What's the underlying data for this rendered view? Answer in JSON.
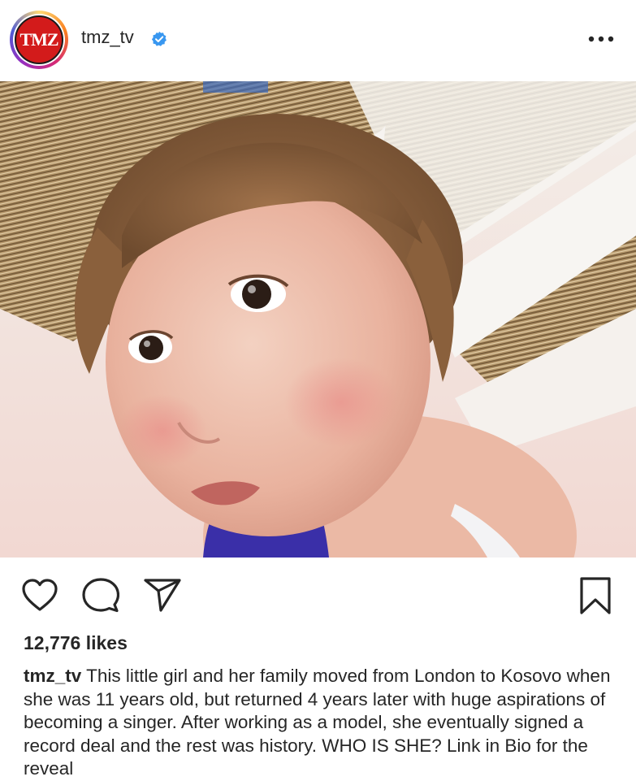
{
  "post": {
    "account": {
      "username": "tmz_tv",
      "avatar_text": "TMZ",
      "verified": true
    },
    "menu_icon": "more-horizontal-icon",
    "photo": {
      "subject": "toddler girl looking at camera under a slatted roof"
    },
    "actions": {
      "like_icon": "heart-icon",
      "comment_icon": "comment-bubble-icon",
      "share_icon": "paper-plane-icon",
      "save_icon": "bookmark-icon"
    },
    "likes": "12,776 likes",
    "caption": {
      "username": "tmz_tv",
      "text": "This little girl and her family moved from London to Kosovo when she was 11 years old, but returned 4 years later with huge aspirations of becoming a singer. After working as a model, she eventually signed a record deal and the rest was history. WHO IS SHE? Link in Bio for the reveal"
    }
  },
  "colors": {
    "text": "#262626",
    "verified_blue": "#3897f0",
    "tmz_red": "#d31b1b"
  }
}
